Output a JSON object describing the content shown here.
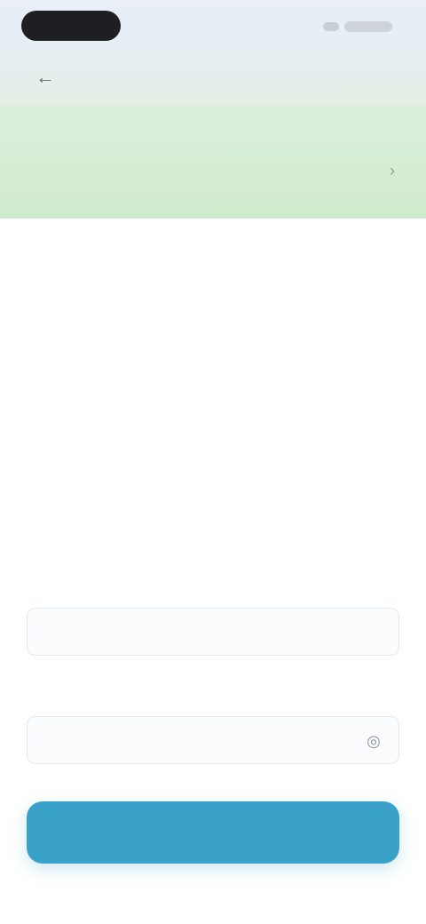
{
  "status": {},
  "header": {
    "title": "",
    "back_icon": "arrow-left-icon"
  },
  "banner": {
    "text": "",
    "chevron_icon": "chevron-right-icon"
  },
  "content": {
    "title": "",
    "subtitle": "",
    "paragraph_1": "",
    "paragraph_2": ""
  },
  "form": {
    "code_label": "",
    "code_value": "",
    "password_label": "",
    "password_value": "",
    "eye_icon": "eye-icon"
  },
  "cta": {
    "label": ""
  },
  "footer": {
    "link_text": ""
  },
  "colors": {
    "accent": "#3aa2c9",
    "banner_bg": "#cfeacd",
    "header_bg": "#e6eef3"
  }
}
